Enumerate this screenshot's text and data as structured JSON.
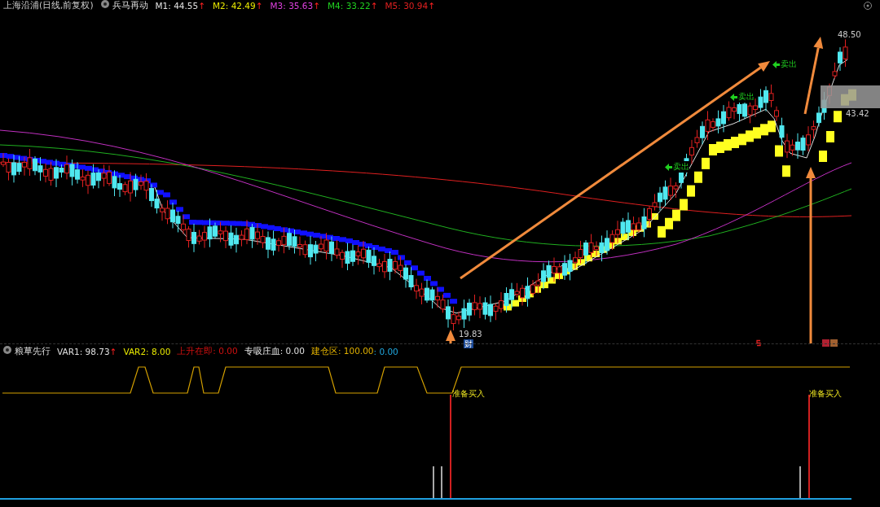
{
  "header": {
    "title": "上海沿浦(日线,前复权)",
    "indicator": "兵马再动",
    "items": [
      {
        "label": "M1: 44.55",
        "arrow": "↑",
        "color": "#e0e0e0"
      },
      {
        "label": "M2: 42.49",
        "arrow": "↑",
        "color": "#e8e800"
      },
      {
        "label": "M3: 35.63",
        "arrow": "↑",
        "color": "#e040e0"
      },
      {
        "label": "M4: 33.22",
        "arrow": "↑",
        "color": "#20d020"
      },
      {
        "label": "M5: 30.94",
        "arrow": "↑",
        "color": "#e02020"
      }
    ]
  },
  "main_chart": {
    "high_label": "48.50",
    "close_label": "43.42",
    "low_label": "19.83",
    "event_label": "财",
    "signals": [
      "卖出",
      "卖出",
      "卖出"
    ]
  },
  "lower_header": {
    "indicator": "粮草先行",
    "items": [
      {
        "label": "VAR1: 98.73",
        "arrow": "↑",
        "color": "#e0e0e0"
      },
      {
        "label": "VAR2: 8.00",
        "color": "#e8e800"
      },
      {
        "label": "上升在即: 0.00",
        "color": "#d01010"
      },
      {
        "label": "专吸庄血: 0.00",
        "color": "#e0e0e0"
      },
      {
        "label": "建仓区: 100.00",
        "color": "#e0b000"
      },
      {
        "label": ": 0.00",
        "color": "#20a8e0"
      }
    ]
  },
  "lower_chart": {
    "signals": [
      "准备买入",
      "准备买入"
    ]
  }
}
